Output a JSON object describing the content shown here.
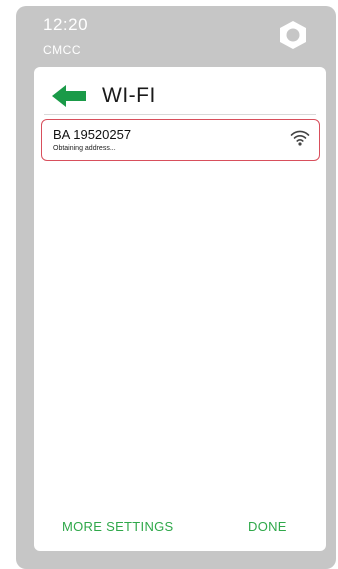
{
  "status_bar": {
    "time": "12:20",
    "carrier": "CMCC",
    "top_right_icon": "hexagon-icon"
  },
  "header": {
    "back_icon": "arrow-left-icon",
    "title": "WI-FI"
  },
  "networks": [
    {
      "name": "BA 19520257",
      "status": "Obtaining address...",
      "signal_icon": "wifi-signal-icon",
      "selected": true
    }
  ],
  "footer": {
    "more_label": "MORE SETTINGS",
    "done_label": "DONE"
  },
  "colors": {
    "accent": "#2fa84a",
    "device_bg": "#c6c6c6",
    "selection_border": "#d84f5c"
  }
}
